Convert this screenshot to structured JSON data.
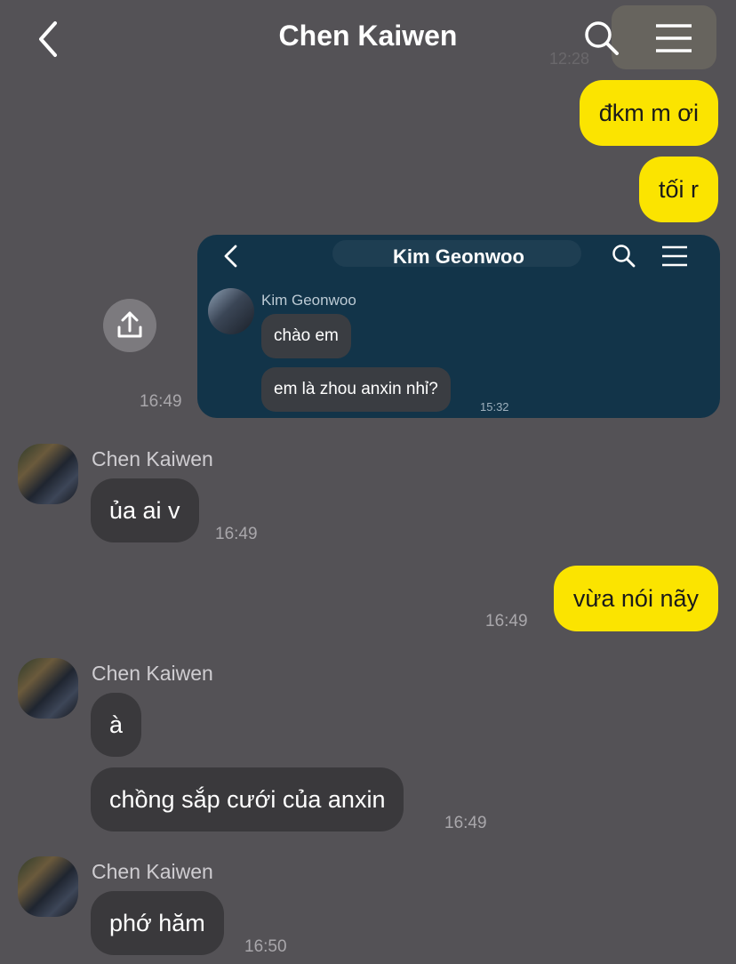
{
  "header": {
    "title": "Chen Kaiwen",
    "back_icon": "chevron-left-icon",
    "search_icon": "search-icon",
    "menu_icon": "menu-icon",
    "ghost_time": "12:28"
  },
  "messages": {
    "m1": {
      "text": "đkm m ơi"
    },
    "m2": {
      "text": "tối r"
    },
    "shared": {
      "time": "16:49",
      "share_icon": "share-icon",
      "screenshot": {
        "title": "Kim Geonwoo",
        "sender": "Kim Geonwoo",
        "bubble1": "chào em",
        "bubble2": "em là zhou anxin nhỉ?",
        "time": "15:32"
      }
    },
    "g1": {
      "sender": "Chen Kaiwen",
      "text": "ủa ai v",
      "time": "16:49"
    },
    "m3": {
      "text": "vừa nói nãy",
      "time": "16:49"
    },
    "g2": {
      "sender": "Chen Kaiwen",
      "text1": "à",
      "text2": "chồng sắp cưới của anxin",
      "time": "16:49"
    },
    "g3": {
      "sender": "Chen Kaiwen",
      "text": "phớ hăm",
      "time": "16:50"
    }
  },
  "colors": {
    "background": "#545256",
    "my_bubble": "#fbe400",
    "their_bubble": "#3a393c",
    "shared_card": "#123449"
  }
}
